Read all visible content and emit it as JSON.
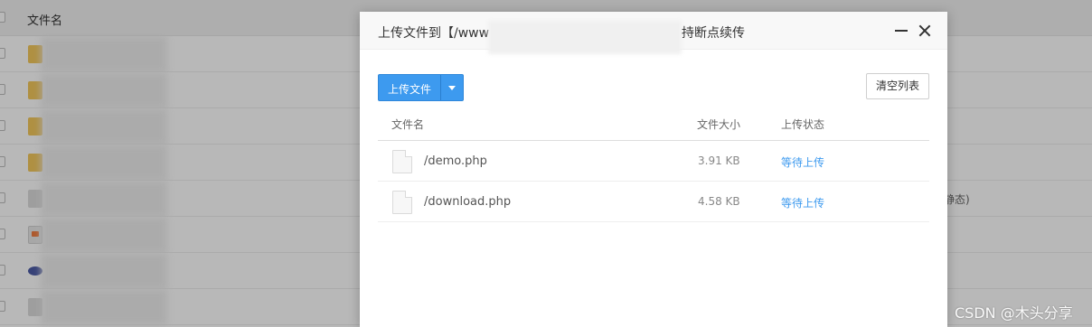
{
  "background": {
    "column_header": "文件名",
    "rows": [
      {
        "type": "folder"
      },
      {
        "type": "folder"
      },
      {
        "type": "folder"
      },
      {
        "type": "folder"
      },
      {
        "type": "doc",
        "note": "静态)"
      },
      {
        "type": "img"
      },
      {
        "type": "php"
      },
      {
        "type": "doc"
      }
    ]
  },
  "dialog": {
    "title_prefix": "上传文件到【/www",
    "title_suffix": "持断点续传",
    "upload_button": "上传文件",
    "clear_button": "清空列表",
    "columns": [
      "文件名",
      "文件大小",
      "上传状态"
    ],
    "files": [
      {
        "name": "/demo.php",
        "size": "3.91 KB",
        "status": "等待上传"
      },
      {
        "name": "/download.php",
        "size": "4.58 KB",
        "status": "等待上传"
      }
    ]
  },
  "watermark": "CSDN @木头分享",
  "colors": {
    "accent": "#3d9aef"
  }
}
